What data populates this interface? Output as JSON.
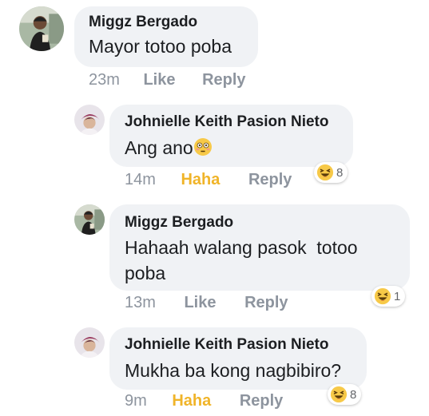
{
  "comments": [
    {
      "author": "Miggz Bergado",
      "text": "Mayor totoo poba",
      "time": "23m",
      "like_label": "Like",
      "reply_label": "Reply"
    },
    {
      "author": "Johnielle Keith Pasion Nieto",
      "text": "Ang ano",
      "inline_emoji": "flushed-face-emoji",
      "time": "14m",
      "reaction_label": "Haha",
      "reply_label": "Reply",
      "reaction_count": "8",
      "reaction_icon": "haha-icon"
    },
    {
      "author": "Miggz Bergado",
      "text_line1": "Hahaah walang pasok  totoo",
      "text_line2": "poba",
      "time": "13m",
      "like_label": "Like",
      "reply_label": "Reply",
      "reaction_count": "1",
      "reaction_icon": "haha-icon"
    },
    {
      "author": "Johnielle Keith Pasion Nieto",
      "text": "Mukha ba kong nagbibiro?",
      "time": "9m",
      "reaction_label": "Haha",
      "reply_label": "Reply",
      "reaction_count": "8",
      "reaction_icon": "haha-icon"
    }
  ],
  "colors": {
    "bubble": "#f0f2f5",
    "meta_text": "#8d949e",
    "haha_active": "#f0b429",
    "emoji_yellow": "#f7c948"
  }
}
